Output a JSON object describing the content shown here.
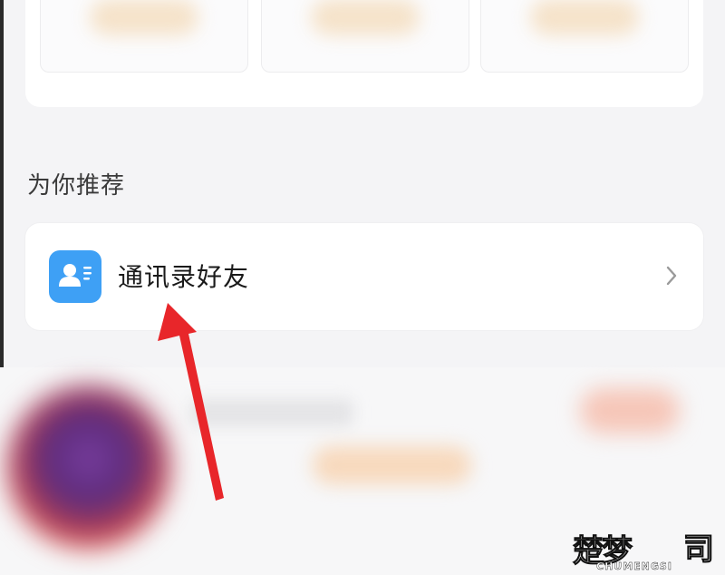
{
  "section": {
    "title": "为你推荐"
  },
  "recommendation": {
    "label": "通讯录好友",
    "icon": "contacts-icon",
    "trailing_icon": "chevron-right-icon"
  },
  "annotation": {
    "color": "#e8262a",
    "icon": "arrow-icon"
  },
  "watermark": {
    "brand": "楚梦",
    "mark": "司",
    "sub": "CHUMENGSI"
  },
  "colors": {
    "accent": "#3ea0f5",
    "annotation": "#e8262a"
  }
}
